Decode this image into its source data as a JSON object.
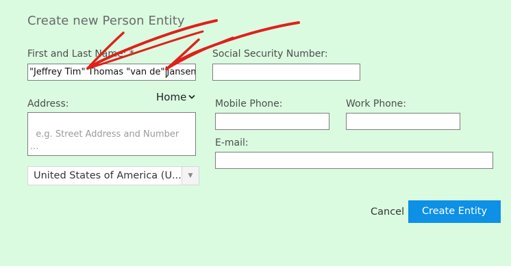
{
  "form": {
    "title": "Create new Person Entity",
    "name_label": "First and Last Name: *",
    "name_value_before_caret": "\"Jeffrey Tim\" Thomas \"van de\"",
    "name_value_after_caret": "Jansen",
    "ssn_label": "Social Security Number:",
    "ssn_value": "",
    "address_label": "Address:",
    "address_type": "Home",
    "address_placeholder": "e.g. Street Address and Number\n...\nZip Code, City",
    "country_value": "United States of America (U...",
    "mobile_label": "Mobile Phone:",
    "mobile_value": "",
    "work_label": "Work Phone:",
    "work_value": "",
    "email_label": "E-mail:",
    "email_value": ""
  },
  "actions": {
    "cancel_label": "Cancel",
    "create_label": "Create Entity"
  },
  "colors": {
    "background": "#dafbe0",
    "primary_button": "#0d90e6",
    "annotation_red": "#e0201c"
  },
  "icons": {
    "address_type_dropdown": "chevron-down-icon",
    "country_dropdown": "dropdown-arrow-icon",
    "textarea_resize": "resize-grip-icon"
  }
}
